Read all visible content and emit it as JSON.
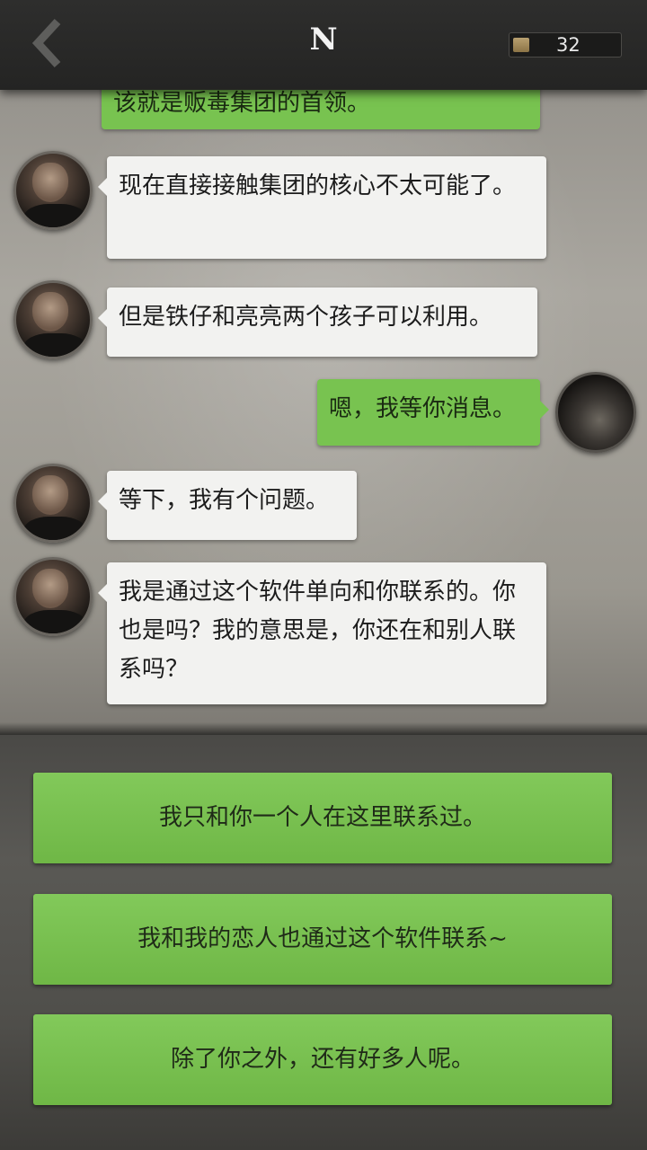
{
  "header": {
    "contact_name": "N",
    "coins": "32"
  },
  "messages": [
    {
      "from": "them",
      "text": "该就是贩毒集团的首领。"
    },
    {
      "from": "them",
      "text": "现在直接接触集团的核心不太可能了。"
    },
    {
      "from": "them",
      "text": "但是铁仔和亮亮两个孩子可以利用。"
    },
    {
      "from": "me",
      "text": "嗯，我等你消息。"
    },
    {
      "from": "them",
      "text": "等下，我有个问题。"
    },
    {
      "from": "them",
      "text": "我是通过这个软件单向和你联系的。你也是吗？我的意思是，你还在和别人联系吗？"
    }
  ],
  "options": [
    "我只和你一个人在这里联系过。",
    "我和我的恋人也通过这个软件联系~",
    "除了你之外，还有好多人呢。"
  ],
  "colors": {
    "bubble_out": "#78c350",
    "bubble_in": "#f2f2f0",
    "option": "#78c350",
    "topbar": "#2a2a29"
  },
  "icons": {
    "back": "chevron-left-icon",
    "coin": "coin-icon"
  }
}
